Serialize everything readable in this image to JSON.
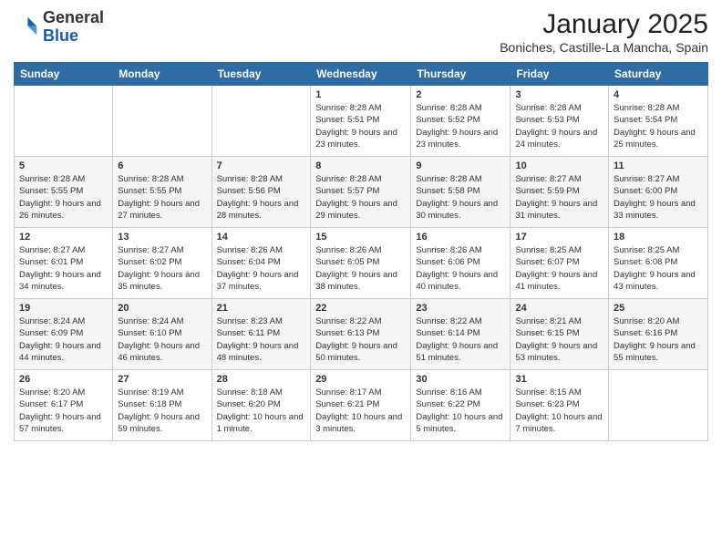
{
  "header": {
    "logo_general": "General",
    "logo_blue": "Blue",
    "month_title": "January 2025",
    "location": "Boniches, Castille-La Mancha, Spain"
  },
  "weekdays": [
    "Sunday",
    "Monday",
    "Tuesday",
    "Wednesday",
    "Thursday",
    "Friday",
    "Saturday"
  ],
  "weeks": [
    [
      {
        "day": "",
        "info": ""
      },
      {
        "day": "",
        "info": ""
      },
      {
        "day": "",
        "info": ""
      },
      {
        "day": "1",
        "info": "Sunrise: 8:28 AM\nSunset: 5:51 PM\nDaylight: 9 hours and 23 minutes."
      },
      {
        "day": "2",
        "info": "Sunrise: 8:28 AM\nSunset: 5:52 PM\nDaylight: 9 hours and 23 minutes."
      },
      {
        "day": "3",
        "info": "Sunrise: 8:28 AM\nSunset: 5:53 PM\nDaylight: 9 hours and 24 minutes."
      },
      {
        "day": "4",
        "info": "Sunrise: 8:28 AM\nSunset: 5:54 PM\nDaylight: 9 hours and 25 minutes."
      }
    ],
    [
      {
        "day": "5",
        "info": "Sunrise: 8:28 AM\nSunset: 5:55 PM\nDaylight: 9 hours and 26 minutes."
      },
      {
        "day": "6",
        "info": "Sunrise: 8:28 AM\nSunset: 5:55 PM\nDaylight: 9 hours and 27 minutes."
      },
      {
        "day": "7",
        "info": "Sunrise: 8:28 AM\nSunset: 5:56 PM\nDaylight: 9 hours and 28 minutes."
      },
      {
        "day": "8",
        "info": "Sunrise: 8:28 AM\nSunset: 5:57 PM\nDaylight: 9 hours and 29 minutes."
      },
      {
        "day": "9",
        "info": "Sunrise: 8:28 AM\nSunset: 5:58 PM\nDaylight: 9 hours and 30 minutes."
      },
      {
        "day": "10",
        "info": "Sunrise: 8:27 AM\nSunset: 5:59 PM\nDaylight: 9 hours and 31 minutes."
      },
      {
        "day": "11",
        "info": "Sunrise: 8:27 AM\nSunset: 6:00 PM\nDaylight: 9 hours and 33 minutes."
      }
    ],
    [
      {
        "day": "12",
        "info": "Sunrise: 8:27 AM\nSunset: 6:01 PM\nDaylight: 9 hours and 34 minutes."
      },
      {
        "day": "13",
        "info": "Sunrise: 8:27 AM\nSunset: 6:02 PM\nDaylight: 9 hours and 35 minutes."
      },
      {
        "day": "14",
        "info": "Sunrise: 8:26 AM\nSunset: 6:04 PM\nDaylight: 9 hours and 37 minutes."
      },
      {
        "day": "15",
        "info": "Sunrise: 8:26 AM\nSunset: 6:05 PM\nDaylight: 9 hours and 38 minutes."
      },
      {
        "day": "16",
        "info": "Sunrise: 8:26 AM\nSunset: 6:06 PM\nDaylight: 9 hours and 40 minutes."
      },
      {
        "day": "17",
        "info": "Sunrise: 8:25 AM\nSunset: 6:07 PM\nDaylight: 9 hours and 41 minutes."
      },
      {
        "day": "18",
        "info": "Sunrise: 8:25 AM\nSunset: 6:08 PM\nDaylight: 9 hours and 43 minutes."
      }
    ],
    [
      {
        "day": "19",
        "info": "Sunrise: 8:24 AM\nSunset: 6:09 PM\nDaylight: 9 hours and 44 minutes."
      },
      {
        "day": "20",
        "info": "Sunrise: 8:24 AM\nSunset: 6:10 PM\nDaylight: 9 hours and 46 minutes."
      },
      {
        "day": "21",
        "info": "Sunrise: 8:23 AM\nSunset: 6:11 PM\nDaylight: 9 hours and 48 minutes."
      },
      {
        "day": "22",
        "info": "Sunrise: 8:22 AM\nSunset: 6:13 PM\nDaylight: 9 hours and 50 minutes."
      },
      {
        "day": "23",
        "info": "Sunrise: 8:22 AM\nSunset: 6:14 PM\nDaylight: 9 hours and 51 minutes."
      },
      {
        "day": "24",
        "info": "Sunrise: 8:21 AM\nSunset: 6:15 PM\nDaylight: 9 hours and 53 minutes."
      },
      {
        "day": "25",
        "info": "Sunrise: 8:20 AM\nSunset: 6:16 PM\nDaylight: 9 hours and 55 minutes."
      }
    ],
    [
      {
        "day": "26",
        "info": "Sunrise: 8:20 AM\nSunset: 6:17 PM\nDaylight: 9 hours and 57 minutes."
      },
      {
        "day": "27",
        "info": "Sunrise: 8:19 AM\nSunset: 6:18 PM\nDaylight: 9 hours and 59 minutes."
      },
      {
        "day": "28",
        "info": "Sunrise: 8:18 AM\nSunset: 6:20 PM\nDaylight: 10 hours and 1 minute."
      },
      {
        "day": "29",
        "info": "Sunrise: 8:17 AM\nSunset: 6:21 PM\nDaylight: 10 hours and 3 minutes."
      },
      {
        "day": "30",
        "info": "Sunrise: 8:16 AM\nSunset: 6:22 PM\nDaylight: 10 hours and 5 minutes."
      },
      {
        "day": "31",
        "info": "Sunrise: 8:15 AM\nSunset: 6:23 PM\nDaylight: 10 hours and 7 minutes."
      },
      {
        "day": "",
        "info": ""
      }
    ]
  ]
}
